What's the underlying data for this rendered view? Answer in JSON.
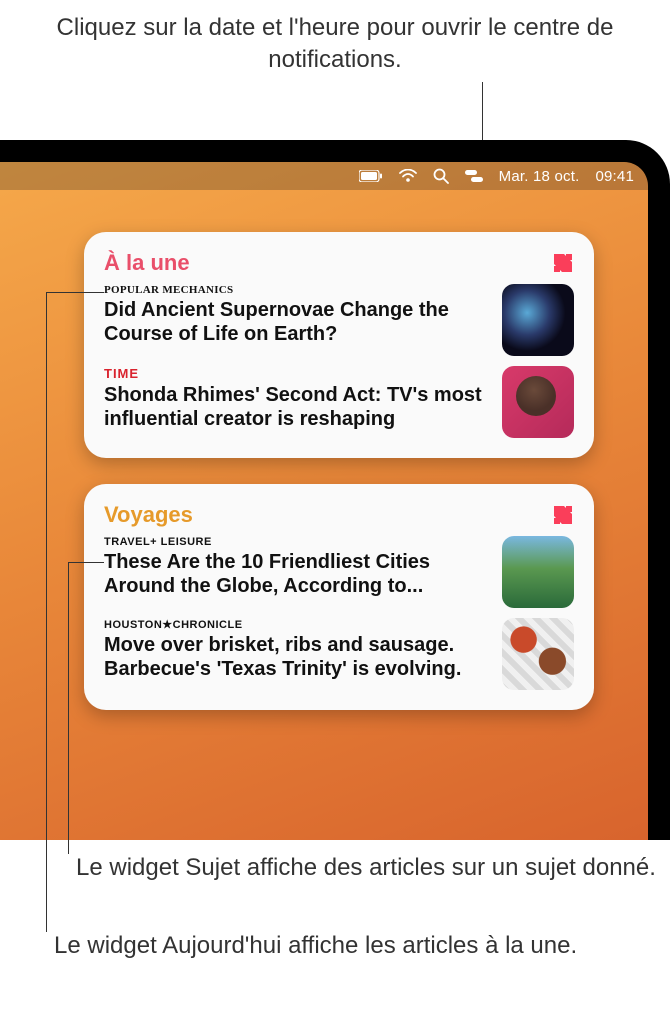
{
  "callouts": {
    "top": "Cliquez sur la date et l'heure pour ouvrir le centre de notifications.",
    "bottom1": "Le widget Sujet affiche des articles sur un sujet donné.",
    "bottom2": "Le widget Aujourd'hui affiche les articles à la une."
  },
  "menubar": {
    "battery_icon": "battery-icon",
    "wifi_icon": "wifi-icon",
    "search_icon": "search-icon",
    "control_center_icon": "control-center-icon",
    "date": "Mar. 18 oct.",
    "time": "09:41"
  },
  "widgets": [
    {
      "title": "À la une",
      "title_color": "pink",
      "app_icon": "apple-news-icon",
      "articles": [
        {
          "source": "POPULAR MECHANICS",
          "source_style": "pm",
          "headline": "Did Ancient Supernovae Change the Course of Life on Earth?",
          "thumb": "space"
        },
        {
          "source": "TIME",
          "source_style": "time",
          "headline": "Shonda Rhimes' Second Act: TV's most influential creator is reshaping",
          "thumb": "person"
        }
      ]
    },
    {
      "title": "Voyages",
      "title_color": "orange",
      "app_icon": "apple-news-icon",
      "articles": [
        {
          "source": "TRAVEL+ LEISURE",
          "source_style": "tl",
          "headline": "These Are the 10 Friendliest Cities Around the Globe, According to...",
          "thumb": "coast"
        },
        {
          "source": "HOUSTON★CHRONICLE",
          "source_style": "hc",
          "headline": "Move over brisket, ribs and sausage. Barbecue's 'Texas Trinity' is evolving.",
          "thumb": "food"
        }
      ]
    }
  ]
}
